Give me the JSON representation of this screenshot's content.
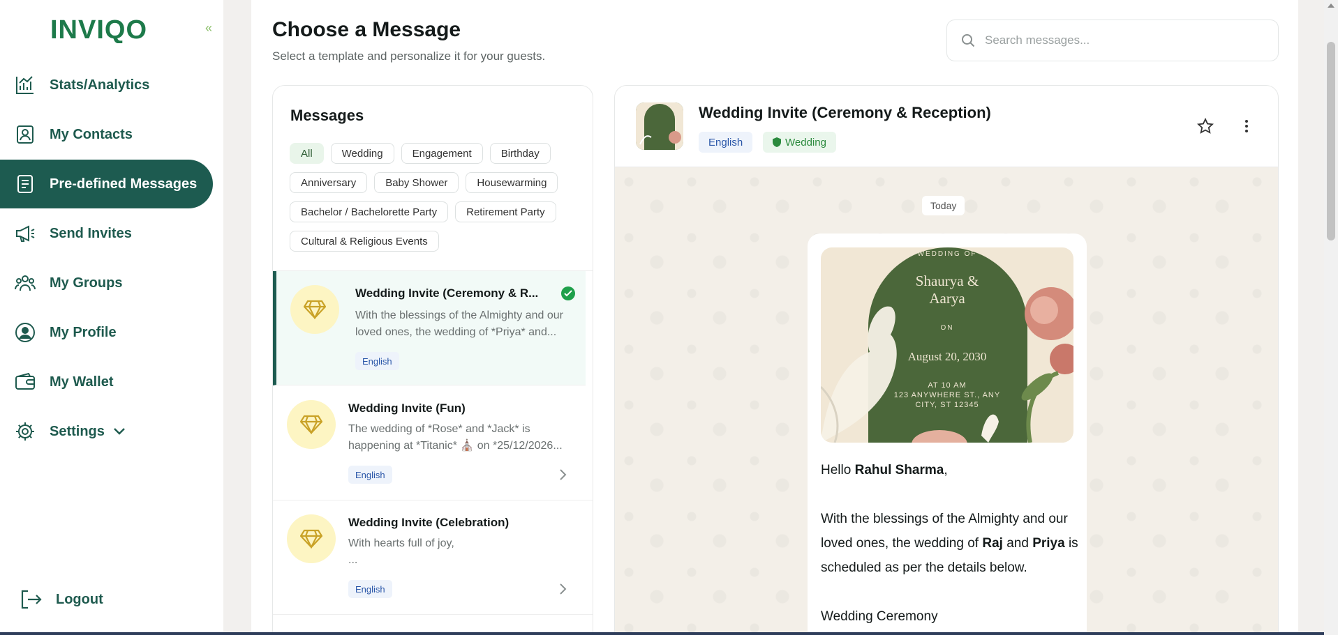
{
  "brand": {
    "logo_text": "INVIQO",
    "collapse_glyph": "«"
  },
  "sidebar": {
    "items": [
      {
        "label": "Stats/Analytics",
        "icon": "chart-icon"
      },
      {
        "label": "My Contacts",
        "icon": "contacts-icon"
      },
      {
        "label": "Pre-defined Messages",
        "icon": "messages-icon",
        "active": true
      },
      {
        "label": "Send Invites",
        "icon": "megaphone-icon"
      },
      {
        "label": "My Groups",
        "icon": "groups-icon"
      },
      {
        "label": "My Profile",
        "icon": "profile-icon"
      },
      {
        "label": "My Wallet",
        "icon": "wallet-icon"
      },
      {
        "label": "Settings",
        "icon": "gear-icon"
      }
    ],
    "logout": "Logout"
  },
  "header": {
    "title": "Choose a Message",
    "subtitle": "Select a template and personalize it for your guests.",
    "search_placeholder": "Search messages..."
  },
  "messages": {
    "heading": "Messages",
    "chips": [
      "All",
      "Wedding",
      "Engagement",
      "Birthday",
      "Anniversary",
      "Baby Shower",
      "Housewarming",
      "Bachelor / Bachelorette Party",
      "Retirement Party",
      "Cultural & Religious Events"
    ],
    "active_chip": "All",
    "items": [
      {
        "title": "Wedding Invite (Ceremony & R...",
        "desc": "With the blessings of the Almighty and our loved ones, the wedding of *Priya* and...",
        "lang": "English",
        "selected": true
      },
      {
        "title": "Wedding Invite (Fun)",
        "desc": "The wedding of *Rose* and *Jack* is happening at *Titanic* ⛪ on *25/12/2026...",
        "lang": "English"
      },
      {
        "title": "Wedding Invite (Celebration)",
        "desc": "With hearts full of joy,\n...",
        "lang": "English"
      }
    ]
  },
  "preview": {
    "title": "Wedding Invite (Ceremony & Reception)",
    "lang_tag": "English",
    "category_tag": "Wedding",
    "day_label": "Today",
    "card": {
      "top": "WEDDING OF",
      "names_1": "Shaurya &",
      "names_2": "Aarya",
      "on": "ON",
      "date": "August 20, 2030",
      "time": "AT 10 AM",
      "addr1": "123 ANYWHERE ST., ANY",
      "addr2": "CITY, ST 12345"
    },
    "greeting": "Hello",
    "guest_name": "Rahul Sharma",
    "body_1": "With the blessings of the Almighty and our loved ones, the wedding of",
    "name_a": "Raj",
    "and": "and",
    "name_b": "Priya",
    "body_2": "is scheduled as per the details below.",
    "section": "Wedding Ceremony"
  },
  "colors": {
    "brand_green": "#1d5b50",
    "accent_green": "#1fa04b",
    "chip_active": "#e9f5ea"
  }
}
